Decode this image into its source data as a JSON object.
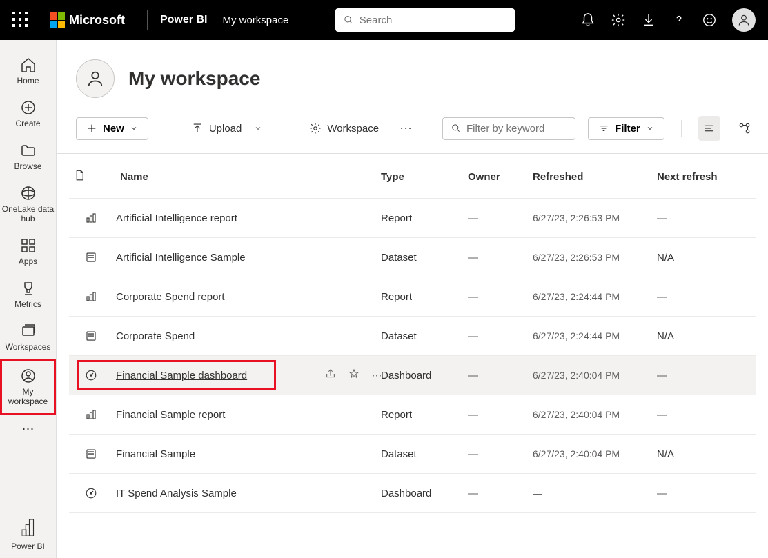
{
  "header": {
    "ms_label": "Microsoft",
    "pbi_label": "Power BI",
    "crumb": "My workspace",
    "search_placeholder": "Search"
  },
  "nav": [
    {
      "label": "Home",
      "icon": "home"
    },
    {
      "label": "Create",
      "icon": "plus-circle"
    },
    {
      "label": "Browse",
      "icon": "folder"
    },
    {
      "label": "OneLake data hub",
      "icon": "globe"
    },
    {
      "label": "Apps",
      "icon": "apps"
    },
    {
      "label": "Metrics",
      "icon": "trophy"
    },
    {
      "label": "Workspaces",
      "icon": "stack"
    },
    {
      "label": "My workspace",
      "icon": "person-circle",
      "highlighted": true
    }
  ],
  "nav_footer": "Power BI",
  "page": {
    "title": "My workspace"
  },
  "toolbar": {
    "new_label": "New",
    "upload_label": "Upload",
    "settings_label": "Workspace",
    "filter_btn_label": "Filter",
    "filter_placeholder": "Filter by keyword"
  },
  "columns": {
    "name": "Name",
    "type": "Type",
    "owner": "Owner",
    "refreshed": "Refreshed",
    "next_refresh": "Next refresh"
  },
  "rows": [
    {
      "icon": "report",
      "name": "Artificial Intelligence report",
      "type": "Report",
      "owner": "—",
      "refreshed": "6/27/23, 2:26:53 PM",
      "next": "—"
    },
    {
      "icon": "dataset",
      "name": "Artificial Intelligence Sample",
      "type": "Dataset",
      "owner": "—",
      "refreshed": "6/27/23, 2:26:53 PM",
      "next": "N/A"
    },
    {
      "icon": "report",
      "name": "Corporate Spend report",
      "type": "Report",
      "owner": "—",
      "refreshed": "6/27/23, 2:24:44 PM",
      "next": "—"
    },
    {
      "icon": "dataset",
      "name": "Corporate Spend",
      "type": "Dataset",
      "owner": "—",
      "refreshed": "6/27/23, 2:24:44 PM",
      "next": "N/A"
    },
    {
      "icon": "dashboard",
      "name": "Financial Sample dashboard",
      "type": "Dashboard",
      "owner": "—",
      "refreshed": "6/27/23, 2:40:04 PM",
      "next": "—",
      "selected": true
    },
    {
      "icon": "report",
      "name": "Financial Sample report",
      "type": "Report",
      "owner": "—",
      "refreshed": "6/27/23, 2:40:04 PM",
      "next": "—"
    },
    {
      "icon": "dataset",
      "name": "Financial Sample",
      "type": "Dataset",
      "owner": "—",
      "refreshed": "6/27/23, 2:40:04 PM",
      "next": "N/A"
    },
    {
      "icon": "dashboard",
      "name": "IT Spend Analysis Sample",
      "type": "Dashboard",
      "owner": "—",
      "refreshed": "—",
      "next": "—"
    }
  ]
}
